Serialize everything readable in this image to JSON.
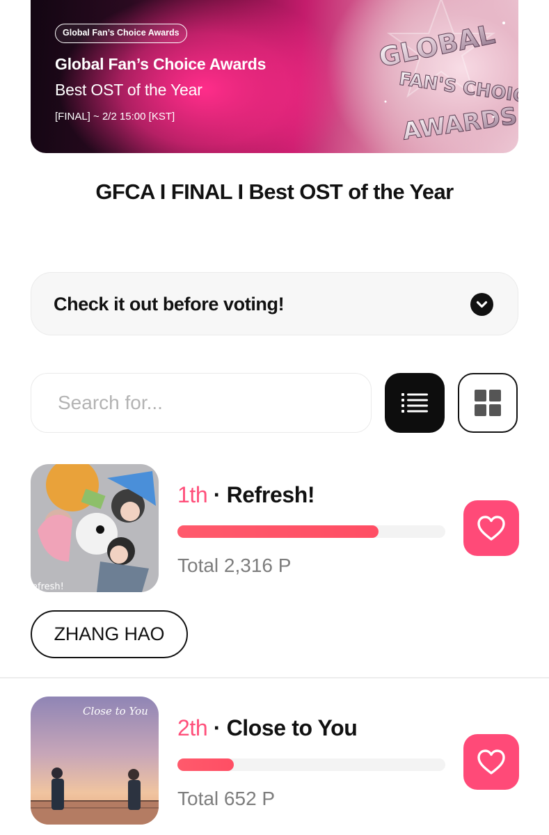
{
  "banner": {
    "chip": "Global Fan’s Choice Awards",
    "title": "Global Fan’s Choice Awards",
    "subtitle": "Best OST of the Year",
    "date": "[FINAL] ~ 2/2 15:00 [KST]",
    "logo_lines": [
      "GLOBAL",
      "FAN'S CHOICE",
      "AWARDS"
    ]
  },
  "page_title": "GFCA I FINAL I Best OST of the Year",
  "accordion": {
    "label": "Check it out before voting!"
  },
  "search": {
    "placeholder": "Search for..."
  },
  "items": [
    {
      "rank": "1th",
      "separator": "·",
      "song": "Refresh!",
      "total": "Total 2,316 P",
      "progress": 0.75,
      "artist": "ZHANG HAO",
      "cover_text": "efresh!"
    },
    {
      "rank": "2th",
      "separator": "·",
      "song": "Close to You",
      "total": "Total 652 P",
      "progress": 0.21,
      "cover_text": "Close to You"
    }
  ],
  "colors": {
    "accent": "#ff4a78",
    "progress": "#ff5a6c",
    "rank": "#ff4f7a"
  }
}
